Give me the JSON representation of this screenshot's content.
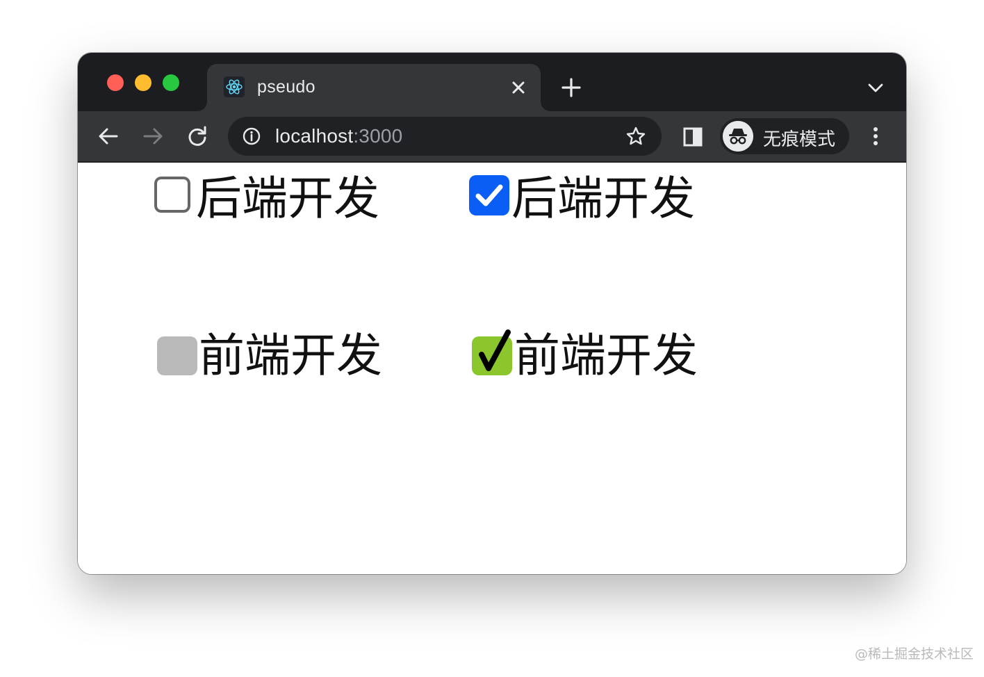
{
  "window": {
    "controls": [
      "close",
      "minimize",
      "zoom"
    ]
  },
  "tab": {
    "title": "pseudo",
    "favicon": "react-logo-icon"
  },
  "toolbar": {
    "url_host": "localhost",
    "url_port": ":3000",
    "profile_label": "无痕模式"
  },
  "content": {
    "items": [
      {
        "label": "后端开发",
        "checked": false,
        "style": "native"
      },
      {
        "label": "后端开发",
        "checked": true,
        "style": "native"
      },
      {
        "label": "前端开发",
        "checked": false,
        "style": "custom"
      },
      {
        "label": "前端开发",
        "checked": true,
        "style": "custom",
        "check_glyph": "✔"
      }
    ]
  },
  "colors": {
    "native_checked": "#0a5ef5",
    "custom_unchecked": "#b9b9b9",
    "custom_checked": "#8bc72c"
  },
  "watermark": "@稀土掘金技术社区"
}
